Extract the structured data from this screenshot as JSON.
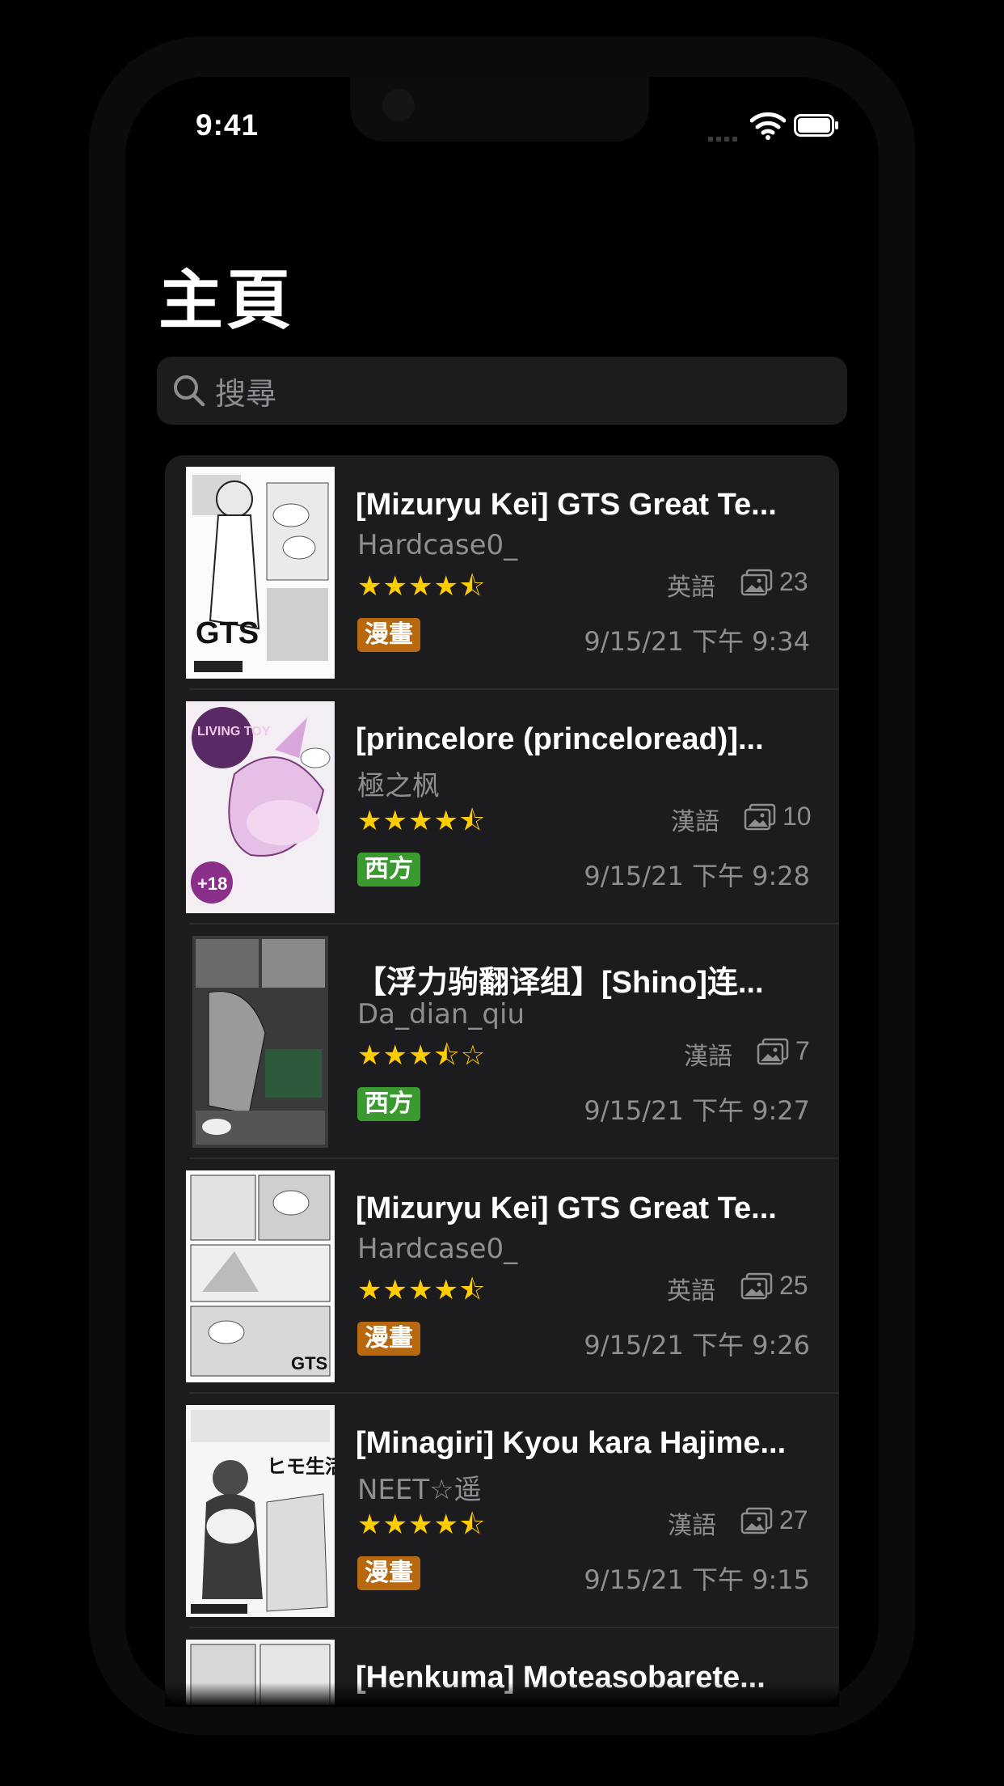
{
  "status_bar": {
    "time": "9:41"
  },
  "header": {
    "title": "主頁"
  },
  "search": {
    "placeholder": "搜尋"
  },
  "colors": {
    "manga_badge": "#b8680f",
    "western_badge": "#3a9a2f",
    "star": "#ffcc00"
  },
  "gallery_list": [
    {
      "title": "[Mizuryu Kei] GTS Great Te...",
      "uploader": "Hardcase0_",
      "stars": "★★★★⯪",
      "rating": 4.5,
      "language": "英語",
      "pages": "23",
      "category": "漫畫",
      "date": "9/15/21 下午 9:34",
      "cover_text": "GTS"
    },
    {
      "title": "[princelore (princeloread)]...",
      "uploader": "極之枫",
      "stars": "★★★★⯪",
      "rating": 4.5,
      "language": "漢語",
      "pages": "10",
      "category": "西方",
      "date": "9/15/21 下午 9:28",
      "cover_text": "LIVING TOY"
    },
    {
      "title": "【浮力驹翻译组】[Shino]连...",
      "uploader": "Da_dian_qiu",
      "stars": "★★★⯪☆",
      "rating": 3.5,
      "language": "漢語",
      "pages": "7",
      "category": "西方",
      "date": "9/15/21 下午 9:27",
      "cover_text": ""
    },
    {
      "title": "[Mizuryu Kei] GTS Great Te...",
      "uploader": "Hardcase0_",
      "stars": "★★★★⯪",
      "rating": 4.5,
      "language": "英語",
      "pages": "25",
      "category": "漫畫",
      "date": "9/15/21 下午 9:26",
      "cover_text": "GTS"
    },
    {
      "title": "[Minagiri] Kyou kara Hajime...",
      "uploader": "NEET☆遥",
      "stars": "★★★★⯪",
      "rating": 4.5,
      "language": "漢語",
      "pages": "27",
      "category": "漫畫",
      "date": "9/15/21 下午 9:15",
      "cover_text": "ヒモ生活"
    },
    {
      "title": "[Henkuma] Moteasobarete...",
      "uploader": "",
      "stars": "",
      "rating": null,
      "language": "",
      "pages": "",
      "category": "",
      "date": "",
      "cover_text": ""
    }
  ]
}
